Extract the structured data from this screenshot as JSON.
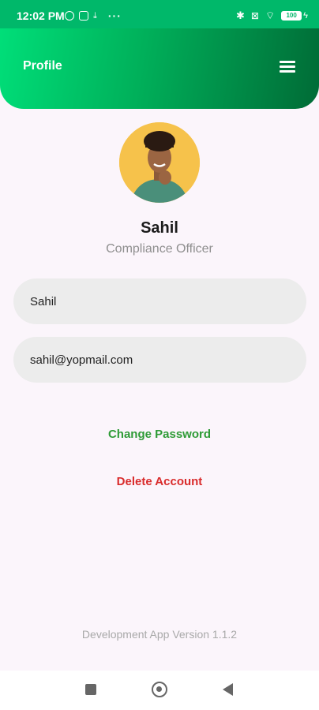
{
  "status_bar": {
    "time": "12:02 PM",
    "battery": "100"
  },
  "header": {
    "title": "Profile"
  },
  "profile": {
    "name": "Sahil",
    "role": "Compliance Officer"
  },
  "form": {
    "name_value": "Sahil",
    "email_value": "sahil@yopmail.com"
  },
  "actions": {
    "change_password_label": "Change Password",
    "delete_account_label": "Delete Account"
  },
  "footer": {
    "version": "Development App Version 1.1.2"
  },
  "colors": {
    "header_gradient_start": "#00e07a",
    "header_gradient_end": "#006b36",
    "change_password": "#2e9b36",
    "delete_account": "#d92b2b",
    "background": "#fbf5fb"
  }
}
